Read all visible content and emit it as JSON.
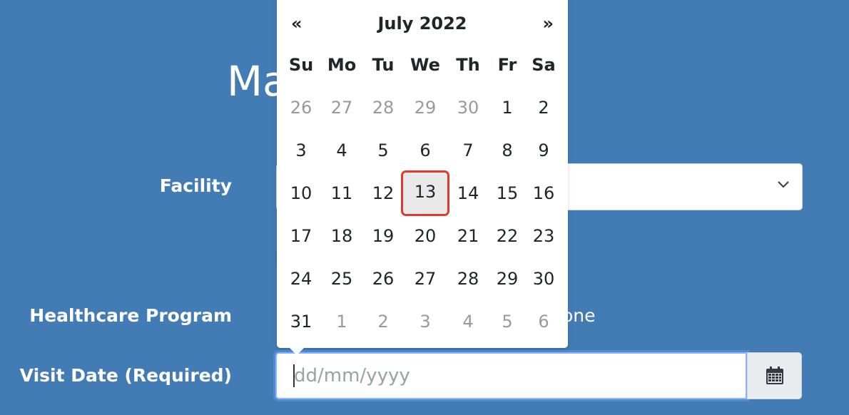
{
  "page": {
    "title_visible": "Ma"
  },
  "form": {
    "facility_label": "Facility",
    "program_label": "Healthcare Program",
    "program_value_visible": "one",
    "visit_date_label": "Visit Date (Required)",
    "visit_date_placeholder": "dd/mm/yyyy"
  },
  "datepicker": {
    "prev": "«",
    "next": "»",
    "month_year": "July 2022",
    "weekdays": [
      "Su",
      "Mo",
      "Tu",
      "We",
      "Th",
      "Fr",
      "Sa"
    ],
    "weeks": [
      [
        "26",
        "27",
        "28",
        "29",
        "30",
        "1",
        "2"
      ],
      [
        "3",
        "4",
        "5",
        "6",
        "7",
        "8",
        "9"
      ],
      [
        "10",
        "11",
        "12",
        "13",
        "14",
        "15",
        "16"
      ],
      [
        "17",
        "18",
        "19",
        "20",
        "21",
        "22",
        "23"
      ],
      [
        "24",
        "25",
        "26",
        "27",
        "28",
        "29",
        "30"
      ],
      [
        "31",
        "1",
        "2",
        "3",
        "4",
        "5",
        "6"
      ]
    ],
    "today": "13"
  },
  "icons": {
    "facility_dropdown": "chevron-down-icon",
    "visit_date_button": "calendar-icon"
  },
  "colors": {
    "background": "#437bb4",
    "today_highlight": "#e03a2e"
  }
}
